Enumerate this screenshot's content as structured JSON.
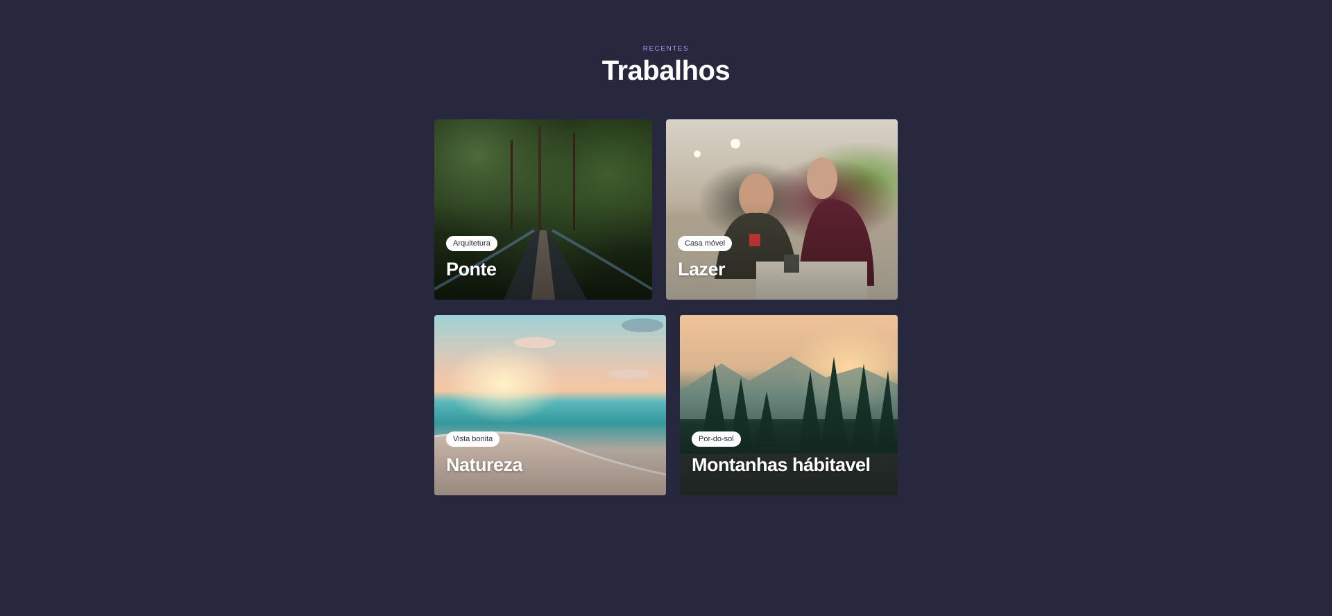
{
  "section": {
    "eyebrow": "RECENTES",
    "title": "Trabalhos"
  },
  "cards": [
    {
      "tag": "Arquitetura",
      "title": "Ponte",
      "image": "forest-bridge"
    },
    {
      "tag": "Casa móvel",
      "title": "Lazer",
      "image": "van-interior"
    },
    {
      "tag": "Vista bonita",
      "title": "Natureza",
      "image": "beach-sunset"
    },
    {
      "tag": "Por-do-sol",
      "title": "Montanhas hábitavel",
      "image": "mountain-forest-sunset"
    }
  ],
  "colors": {
    "background": "#27273e",
    "eyebrow": "#a898f0",
    "title": "#ffffff",
    "tag_bg": "#ffffff",
    "tag_text": "#27273e"
  }
}
